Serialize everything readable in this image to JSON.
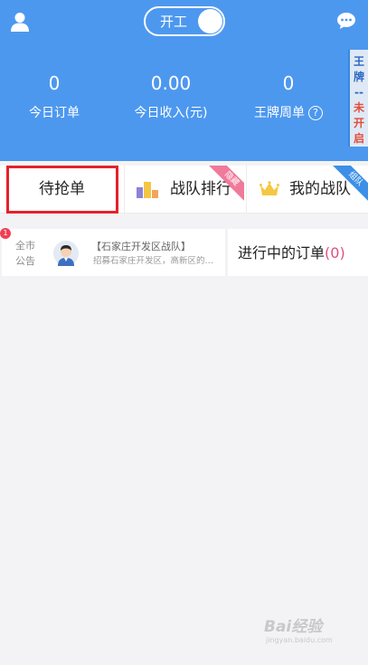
{
  "header": {
    "user_icon": "user-icon",
    "work_toggle": {
      "label": "开工",
      "state": "on"
    },
    "chat_icon": "chat-bubble-icon",
    "background_color": "#4d98ef"
  },
  "stats": [
    {
      "value": "0",
      "label": "今日订单"
    },
    {
      "value": "0.00",
      "label": "今日收入(元)"
    },
    {
      "value": "0",
      "label": "王牌周单"
    }
  ],
  "side_tab": {
    "title": "王牌",
    "dash": "--",
    "status": "未开启"
  },
  "cards": [
    {
      "label": "待抢单"
    },
    {
      "label": "战队排行",
      "ribbon": "隐藏",
      "icon": "ranking-podium-icon"
    },
    {
      "label": "我的战队",
      "ribbon": "组队",
      "icon": "crown-icon"
    }
  ],
  "notice": {
    "badge": "1",
    "tag": "全市公告",
    "avatar": "avatar-icon",
    "title": "【石家庄开发区战队】",
    "desc": "招募石家庄开发区，高新区的队..."
  },
  "orders": {
    "label": "进行中的订单",
    "count_open": "(",
    "count": "0",
    "count_close": ")"
  },
  "watermark": {
    "logo": "Bai经验",
    "url": "jingyan.baidu.com"
  },
  "colors": {
    "highlight": "#e5212a",
    "ribbon_pink": "#f07a9a",
    "ribbon_blue": "#3d8fe8",
    "count": "#e24e84"
  }
}
